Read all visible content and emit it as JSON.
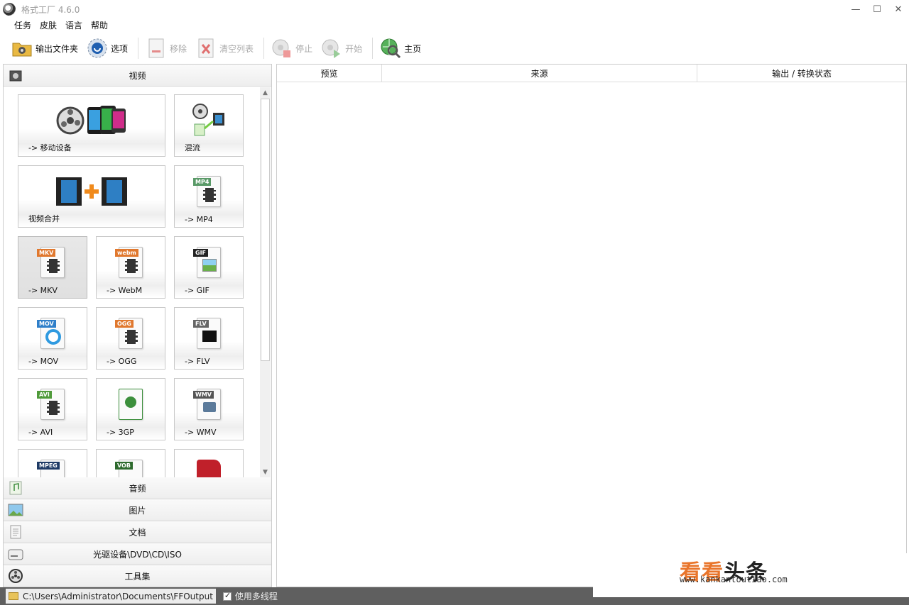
{
  "window": {
    "title": "格式工厂 4.6.0",
    "minimize_icon": "—",
    "maximize_icon": "☐",
    "close_icon": "✕"
  },
  "menu": [
    "任务",
    "皮肤",
    "语言",
    "帮助"
  ],
  "toolbar": {
    "output_folder": "输出文件夹",
    "options": "选项",
    "remove": "移除",
    "clear_list": "清空列表",
    "stop": "停止",
    "start": "开始",
    "home": "主页"
  },
  "left": {
    "video_header": "视频",
    "tiles": [
      {
        "label": "-> 移动设备",
        "tag": ""
      },
      {
        "label": "混流",
        "tag": ""
      },
      {
        "label": "视频合并",
        "tag": ""
      },
      {
        "label": "-> MP4",
        "tag": "MP4",
        "color": "#5a9a68"
      },
      {
        "label": "-> MKV",
        "tag": "MKV",
        "color": "#e0782e"
      },
      {
        "label": "-> WebM",
        "tag": "webm",
        "color": "#e0782e"
      },
      {
        "label": "-> GIF",
        "tag": "GIF",
        "color": "#222222"
      },
      {
        "label": "-> MOV",
        "tag": "MOV",
        "color": "#2f7fc9"
      },
      {
        "label": "-> OGG",
        "tag": "OGG",
        "color": "#e0782e"
      },
      {
        "label": "-> FLV",
        "tag": "FLV",
        "color": "#666666"
      },
      {
        "label": "-> AVI",
        "tag": "AVI",
        "color": "#4f9a3a"
      },
      {
        "label": "-> 3GP",
        "tag": "",
        "color": "#3c8f3c"
      },
      {
        "label": "-> WMV",
        "tag": "WMV",
        "color": "#555555"
      },
      {
        "label": "",
        "tag": "MPEG",
        "color": "#1f3b66"
      },
      {
        "label": "",
        "tag": "VOB",
        "color": "#2e6a2e"
      },
      {
        "label": "",
        "tag": "",
        "color": "#c0202a"
      }
    ],
    "categories": [
      "音频",
      "图片",
      "文档",
      "光驱设备\\DVD\\CD\\ISO",
      "工具集"
    ]
  },
  "right": {
    "columns": [
      "预览",
      "来源",
      "输出 / 转换状态"
    ]
  },
  "status": {
    "output_path": "C:\\Users\\Administrator\\Documents\\FFOutput",
    "multithread_label": "使用多线程"
  },
  "watermark": {
    "text_orange": "看看",
    "text_black": "头条",
    "url": "www.kankantoutiao.com"
  }
}
